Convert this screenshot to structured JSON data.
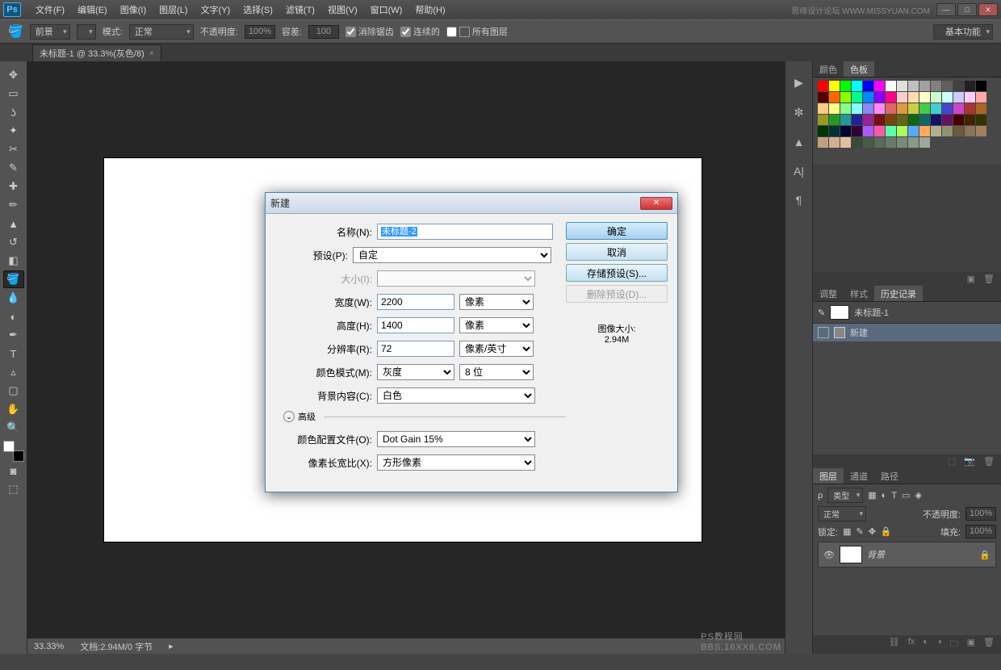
{
  "menu": [
    "文件(F)",
    "编辑(E)",
    "图像(I)",
    "图层(L)",
    "文字(Y)",
    "选择(S)",
    "滤镜(T)",
    "视图(V)",
    "窗口(W)",
    "帮助(H)"
  ],
  "watermark": "思缘设计论坛  WWW.MISSYUAN.COM",
  "optbar": {
    "fill": "前景",
    "mode_lbl": "模式:",
    "mode": "正常",
    "opacity_lbl": "不透明度:",
    "opacity": "100%",
    "tolerance_lbl": "容差:",
    "tolerance": "100",
    "antialias": "消除锯齿",
    "contiguous": "连续的",
    "alllayers": "所有图层",
    "essentials": "基本功能"
  },
  "doctab": {
    "label": "未标题-1 @ 33.3%(灰色/8)",
    "close": "×"
  },
  "panels": {
    "color_tab": "颜色",
    "swatch_tab": "色板",
    "adjust_tab": "调整",
    "styles_tab": "样式",
    "history_tab": "历史记录",
    "hist_doc": "未标题-1",
    "hist_item": "新建",
    "layers_tab": "图层",
    "channels_tab": "通道",
    "paths_tab": "路径",
    "kind": "类型",
    "blend": "正常",
    "opacity_lbl": "不透明度:",
    "opacity": "100%",
    "lock_lbl": "锁定:",
    "fill_lbl": "填充:",
    "fill": "100%",
    "layer_name": "背景"
  },
  "swatch_colors": [
    "#ff0000",
    "#ffff00",
    "#00ff00",
    "#00ffff",
    "#0000ff",
    "#ff00ff",
    "#ffffff",
    "#e0e0e0",
    "#c0c0c0",
    "#a0a0a0",
    "#808080",
    "#606060",
    "#404040",
    "#202020",
    "#000000",
    "#550000",
    "#ff6600",
    "#88ff00",
    "#00ff88",
    "#0088ff",
    "#8800ff",
    "#ff0088",
    "#ffcccc",
    "#ffddaa",
    "#ffffcc",
    "#ccffcc",
    "#ccffff",
    "#ccccff",
    "#ffccff",
    "#ffaaaa",
    "#ffcc88",
    "#ffff88",
    "#88ff88",
    "#88ffff",
    "#8888ff",
    "#ff88ff",
    "#dd6666",
    "#dd9944",
    "#cccc44",
    "#44cc44",
    "#44cccc",
    "#4444cc",
    "#cc44cc",
    "#aa3333",
    "#aa6622",
    "#999922",
    "#229922",
    "#229999",
    "#222299",
    "#992299",
    "#771111",
    "#774411",
    "#666611",
    "#116611",
    "#116666",
    "#111166",
    "#661166",
    "#440000",
    "#442200",
    "#333300",
    "#003300",
    "#003333",
    "#000033",
    "#330033",
    "#a85aff",
    "#ff5aa8",
    "#5affa8",
    "#a8ff5a",
    "#5aa8ff",
    "#ffa85a",
    "#b0b090",
    "#909070",
    "#6b5b3e",
    "#8b7355",
    "#a08060",
    "#c0a080",
    "#d0b090",
    "#e0c0a0",
    "#3a4a3a",
    "#4a5a4a",
    "#5a6a5a",
    "#6a7a6a",
    "#7a8a7a",
    "#8a9a8a",
    "#9aaa9a"
  ],
  "dialog": {
    "title": "新建",
    "name_lbl": "名称(N):",
    "name": "未标题-2",
    "preset_lbl": "预设(P):",
    "preset": "自定",
    "size_lbl": "大小(I):",
    "width_lbl": "宽度(W):",
    "width": "2200",
    "width_unit": "像素",
    "height_lbl": "高度(H):",
    "height": "1400",
    "height_unit": "像素",
    "res_lbl": "分辨率(R):",
    "res": "72",
    "res_unit": "像素/英寸",
    "mode_lbl": "颜色模式(M):",
    "mode": "灰度",
    "bits": "8 位",
    "bg_lbl": "背景内容(C):",
    "bg": "白色",
    "adv": "高级",
    "profile_lbl": "颜色配置文件(O):",
    "profile": "Dot Gain 15%",
    "aspect_lbl": "像素长宽比(X):",
    "aspect": "方形像素",
    "ok": "确定",
    "cancel": "取消",
    "save": "存储预设(S)...",
    "delete": "删除预设(D)...",
    "img_size_lbl": "图像大小:",
    "img_size": "2.94M"
  },
  "status": {
    "zoom": "33.33%",
    "doc": "文档:2.94M/0 字节",
    "corner1": "PS教程网",
    "corner2": "BBS.16XX8.COM"
  }
}
